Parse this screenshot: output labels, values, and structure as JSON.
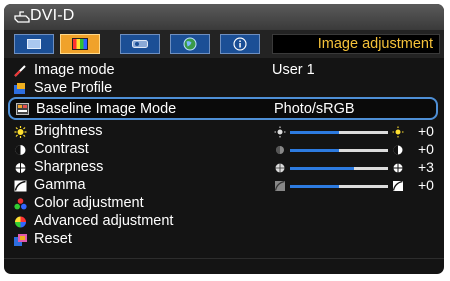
{
  "window": {
    "title": "DVI-D"
  },
  "tabs": [
    {
      "name": "image-tab",
      "active": false
    },
    {
      "name": "image-adjustment-tab",
      "active": true
    },
    {
      "name": "setup-tab",
      "active": false
    },
    {
      "name": "network-tab",
      "active": false
    },
    {
      "name": "info-tab",
      "active": false
    }
  ],
  "tab_label": "Image adjustment",
  "menu": {
    "image_mode": {
      "label": "Image mode",
      "value": "User 1"
    },
    "save_profile": {
      "label": "Save Profile"
    },
    "baseline_image_mode": {
      "label": "Baseline Image Mode",
      "value": "Photo/sRGB"
    },
    "brightness": {
      "label": "Brightness",
      "value": "+0",
      "level": 0.5
    },
    "contrast": {
      "label": "Contrast",
      "value": "+0",
      "level": 0.5
    },
    "sharpness": {
      "label": "Sharpness",
      "value": "+3",
      "level": 0.65
    },
    "gamma": {
      "label": "Gamma",
      "value": "+0",
      "level": 0.5
    },
    "color_adjustment": {
      "label": "Color adjustment"
    },
    "advanced_adjustment": {
      "label": "Advanced adjustment"
    },
    "reset": {
      "label": "Reset"
    }
  },
  "colors": {
    "accent": "#f0a22a",
    "highlight_border": "#4e8fd6",
    "slider_fill": "#2d7be0",
    "tab_blue": "#1b4f96",
    "label_yellow": "#f5c23a"
  }
}
